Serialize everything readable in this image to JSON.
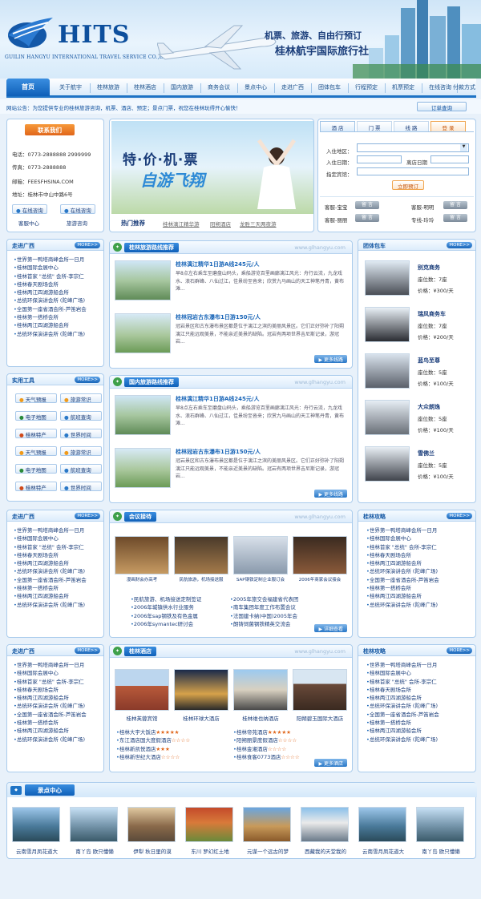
{
  "header": {
    "logo_text": "HITS",
    "logo_sub": "GUILIN HANGYU INTERNATIONAL TRAVEL SERVICE CO.,LTD",
    "slogan1": "机票、旅游、自由行预订",
    "slogan2": "桂林航宇国际旅行社"
  },
  "nav": {
    "items": [
      "首页",
      "关于航宇",
      "桂林旅游",
      "桂林酒店",
      "国内旅游",
      "商务会议",
      "景点中心",
      "走进广西",
      "团体包车",
      "行程预定",
      "机票预定",
      "在线咨询",
      "付款方式"
    ]
  },
  "notice": {
    "text": "网站公告：为您提供专业的桂林旅游咨询，机票、酒店、预定；景点门票，祝您在桂林玩得开心愉快！",
    "order_label": "订单查询"
  },
  "contact": {
    "title": "联系我们",
    "phone_label": "电话：0773-2888888  2999999",
    "fax_label": "传真：0773-2888888",
    "email_label": "邮箱：FEESFHSINA.COM",
    "address_label": "地址：桂林市中山中路6号",
    "btn1": "在线咨询",
    "btn2": "在线咨询",
    "name1": "客服中心",
    "name2": "旅游咨询"
  },
  "banner": {
    "main_text": "特·价·机·票",
    "sub_text": "自游飞翔",
    "hot_label": "热门推荐",
    "hot_links": [
      "桂林漓江精华游",
      "阳朔酒店",
      "龙胜三天两夜游"
    ]
  },
  "booking": {
    "tabs": [
      "酒 店",
      "门 票",
      "线 路",
      "登 录"
    ],
    "checkin_area": "入住地区：",
    "checkin_date": "入住日期：",
    "checkout_date": "离店日期",
    "hotel_name": "指定宾馆：",
    "submit": "立即预订",
    "service": [
      {
        "label": "客服-宝宝",
        "btn": "留 言"
      },
      {
        "label": "客服-明明",
        "btn": "留 言"
      },
      {
        "label": "客服-丽丽",
        "btn": "留 言"
      },
      {
        "label": "专线-玲玲",
        "btn": "留 言"
      }
    ]
  },
  "left_guangxi": {
    "title": "走进广西",
    "more": "MORE>>",
    "items": [
      "世界第一鸭塔商峰会所一日月",
      "桂林国际会展中心",
      "桂林首家 \"总统\" 会所-李宗仁",
      "桂林春天剧场会所",
      "桂林两江四湖游船会所",
      "总统环保演讲会所 (陀峰广场)",
      "全国第一座省酒会所-芦笛岩会",
      "桂林第一搭桥会所",
      "桂林两江四湖游船会所",
      "总统环保演讲会所 (陀峰广场)"
    ]
  },
  "tools": {
    "title": "实用工具",
    "more": "MORE>>",
    "items": [
      "天气预报",
      "旅游常识",
      "电子地图",
      "航班查询",
      "桂林特产",
      "世界时间",
      "天气预报",
      "旅游常识",
      "电子地图",
      "航班查询",
      "桂林特产",
      "世界时间"
    ]
  },
  "left_guangxi2": {
    "title": "走进广西",
    "more": "MORE>>",
    "items": [
      "世界第一鸭塔商峰会所一日月",
      "桂林国际会展中心",
      "桂林首家 \"总统\" 会所-李宗仁",
      "桂林春天剧场会所",
      "桂林两江四湖游船会所",
      "总统环保演讲会所 (陀峰广场)",
      "全国第一座省酒会所-芦笛岩会",
      "桂林第一搭桥会所",
      "桂林两江四湖游船会所",
      "总统环保演讲会所 (陀峰广场)"
    ]
  },
  "left_guangxi3": {
    "title": "走进广西",
    "more": "MORE>>",
    "items": [
      "世界第一鸭塔商峰会所一日月",
      "桂林国际会展中心",
      "桂林首家 \"总统\" 会所-李宗仁",
      "桂林春天剧场会所",
      "桂林两江四湖游船会所",
      "总统环保演讲会所 (陀峰广场)",
      "全国第一座省酒会所-芦笛岩会",
      "桂林第一搭桥会所",
      "桂林两江四湖游船会所",
      "总统环保演讲会所 (陀峰广场)"
    ]
  },
  "routes_guilin": {
    "title": "桂林旅游路线推荐",
    "watermark": "www.glhangyu.com",
    "more": "更多线路",
    "items": [
      {
        "title": "桂林漓江精华1日游A线245元/人",
        "desc": "早8点左右乘车至磨盘山码头，乘船游览百里画廊漓江风光：舟行云流，九龙戏水、浪石群峰、八仙过江，佳景纷至沓来；欣赏九马画山的天工神笔丹青，黄布滩..."
      },
      {
        "title": "桂林冠岩古东瀑布1日游150元/人",
        "desc": "冠岩景区和古东瀑布景区都是位于漓江之滨的美丽风景区。它们正好弥补了阳朔漓江只能远观美景，不能亲近美景的缺陷。冠岩有两项世界吉尼斯记录，游冠岩..."
      }
    ]
  },
  "routes_domestic": {
    "title": "国内旅游路线推荐",
    "watermark": "www.glhangyu.com",
    "more": "更多线路",
    "items": [
      {
        "title": "桂林漓江精华1日游A线245元/人",
        "desc": "早8点左右乘车至磨盘山码头，乘船游览百里画廊漓江风光：舟行云流，九龙戏水、浪石群峰、八仙过江，佳景纷至沓来；欣赏九马画山的天工神笔丹青，黄布滩..."
      },
      {
        "title": "桂林冠岩古东瀑布1日游150元/人",
        "desc": "冠岩景区和古东瀑布景区都是位于漓江之滨的美丽风景区。它们正好弥补了阳朔漓江只能远观美景，不能亲近美景的缺陷。冠岩有两项世界吉尼斯记录，游冠岩..."
      }
    ]
  },
  "meeting": {
    "title": "会议接待",
    "watermark": "www.glhangyu.com",
    "more": "详细查看",
    "photos": [
      "漫画财会办高考",
      "民航旅游，机场接送服",
      "SAP钢铁定制企业服订会",
      "2006年商家会议接会"
    ],
    "left": [
      "民航旅游、机场接送定制签证",
      "2006年城镇供水行业服务",
      "2006年sap钢铁及有色金属",
      "2006年symantec研讨会"
    ],
    "right": [
      "2005年旅交会福建省代表团",
      "南车集团年度工作布置会议",
      "法国建卡纳(中国)2005年会",
      "朗铸饲菌钢铁精英交流会"
    ]
  },
  "hotels": {
    "title": "桂林酒店",
    "watermark": "www.glhangyu.com",
    "more": "更多酒店",
    "photos": [
      "桂林芙蓉宾馆",
      "桂林环球大酒店",
      "桂林维也纳酒店",
      "阳朔碧玉国际大酒店"
    ],
    "left": [
      {
        "name": "桂林大宇大饭店",
        "stars": "★★★★★"
      },
      {
        "name": "东江酒店国大度假酒店",
        "stars": "☆☆☆☆"
      },
      {
        "name": "桂林新凯悦酒店",
        "stars": "★★★"
      },
      {
        "name": "桂林新世纪大酒店",
        "stars": "☆☆☆☆"
      }
    ],
    "right": [
      {
        "name": "桂林帝苑酒店",
        "stars": "★★★★★"
      },
      {
        "name": "阳朔丽景度假酒店",
        "stars": "☆☆☆☆"
      },
      {
        "name": "桂林金湘酒店",
        "stars": "☆☆☆☆"
      },
      {
        "name": "桂林食客0773酒店",
        "stars": "☆☆☆☆"
      }
    ]
  },
  "charter": {
    "title": "团体包车",
    "more": "MORE>>",
    "seat_prefix": "座位数：",
    "price_prefix": "价格：",
    "cars": [
      {
        "name": "别克商务",
        "seats": "7座",
        "price": "¥300/天"
      },
      {
        "name": "瑞风商务车",
        "seats": "7座",
        "price": "¥200/天"
      },
      {
        "name": "蓝鸟至尊",
        "seats": "5座",
        "price": "¥100/天"
      },
      {
        "name": "大众朗逸",
        "seats": "5座",
        "price": "¥100/天"
      },
      {
        "name": "雪佛兰",
        "seats": "5座",
        "price": "¥100/天"
      }
    ]
  },
  "strategy1": {
    "title": "桂林攻略",
    "more": "MORE>>",
    "items": [
      "世界第一鸭塔商峰会所一日月",
      "桂林国际会展中心",
      "桂林首家 \"总统\" 会所-李宗仁",
      "桂林春天剧场会所",
      "桂林两江四湖游船会所",
      "总统环保演讲会所 (陀峰广场)",
      "全国第一座省酒会所-芦笛岩会",
      "桂林第一搭桥会所",
      "桂林两江四湖游船会所",
      "总统环保演讲会所 (陀峰广场)"
    ]
  },
  "strategy2": {
    "title": "桂林攻略",
    "more": "MORE>>",
    "items": [
      "世界第一鸭塔商峰会所一日月",
      "桂林国际会展中心",
      "桂林首家 \"总统\" 会所-李宗仁",
      "桂林春天剧场会所",
      "桂林两江四湖游船会所",
      "总统环保演讲会所 (陀峰广场)",
      "全国第一座省酒会所-芦笛岩会",
      "桂林第一搭桥会所",
      "桂林两江四湖游船会所",
      "总统环保演讲会所 (陀峰广场)"
    ]
  },
  "scenic": {
    "title": "景点中心",
    "items": [
      "云南雪月凤花道大",
      "南丫岛 欧只懂懒",
      "伊犁  秋日里的漠",
      "东川  罗幻红土地",
      "元谋一个远古的梦",
      "西藏我的天堂我的",
      "云南雪月凤花道大",
      "南丫岛 欧只懂懒"
    ]
  }
}
